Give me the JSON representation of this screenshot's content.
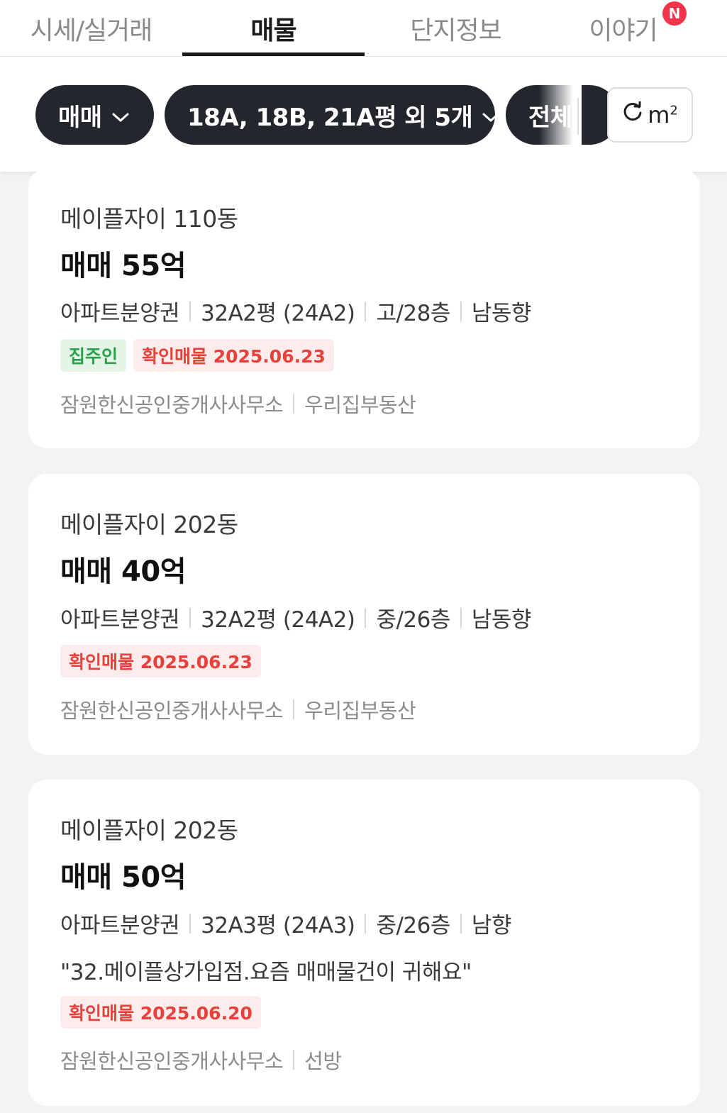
{
  "tabs": [
    {
      "label": "시세/실거래"
    },
    {
      "label": "매물"
    },
    {
      "label": "단지정보"
    },
    {
      "label": "이야기"
    }
  ],
  "new_badge": "N",
  "filters": {
    "trade_type": "매매",
    "sizes": "18A, 18B, 21A평 외 5개",
    "third_chip": "전체",
    "unit": "m",
    "unit_sup": "2"
  },
  "listings": [
    {
      "title": "메이플자이 110동",
      "price": "매매 55억",
      "specs": [
        "아파트분양권",
        "32A2평 (24A2)",
        "고/28층",
        "남동향"
      ],
      "tags": [
        {
          "text": "집주인",
          "color": "green"
        },
        {
          "text": "확인매물 2025.06.23",
          "color": "red"
        }
      ],
      "note": "",
      "agents": [
        "잠원한신공인중개사사무소",
        "우리집부동산"
      ]
    },
    {
      "title": "메이플자이 202동",
      "price": "매매 40억",
      "specs": [
        "아파트분양권",
        "32A2평 (24A2)",
        "중/26층",
        "남동향"
      ],
      "tags": [
        {
          "text": "확인매물 2025.06.23",
          "color": "red"
        }
      ],
      "note": "",
      "agents": [
        "잠원한신공인중개사사무소",
        "우리집부동산"
      ]
    },
    {
      "title": "메이플자이 202동",
      "price": "매매 50억",
      "specs": [
        "아파트분양권",
        "32A3평 (24A3)",
        "중/26층",
        "남향"
      ],
      "tags": [
        {
          "text": "확인매물 2025.06.20",
          "color": "red"
        }
      ],
      "note": "\"32.메이플상가입점.요즘 매매물건이 귀해요\"",
      "agents": [
        "잠원한신공인중개사사무소",
        "선방"
      ]
    }
  ]
}
